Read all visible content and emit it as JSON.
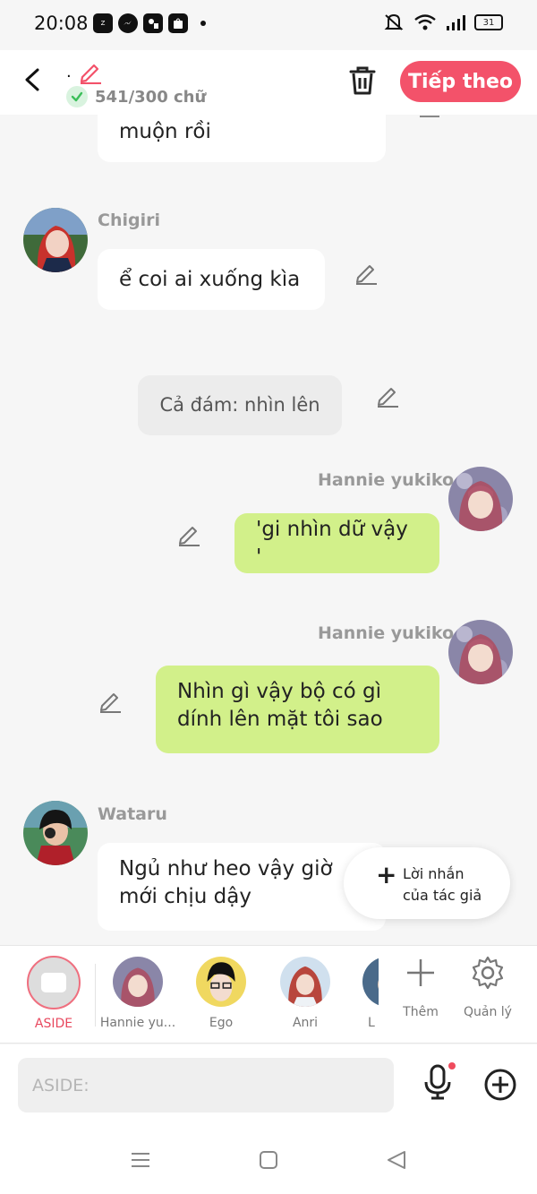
{
  "status_bar": {
    "time": "20:08",
    "app_icons": [
      "zalo-icon",
      "messenger-icon",
      "facebook-icon",
      "shopee-icon"
    ],
    "battery": "31"
  },
  "header": {
    "title": ".",
    "word_count": "541/300 chữ",
    "next_label": "Tiếp theo",
    "accent_color": "#f3526a"
  },
  "messages": [
    {
      "kind": "partial",
      "text": "muộn rồi"
    },
    {
      "sender": "Chigiri",
      "text": "ể coi ai xuống kìa"
    },
    {
      "kind": "narration",
      "text": "Cả đám: nhìn lên"
    },
    {
      "sender": "Hannie yukiko",
      "text": "'gi nhìn dữ vậy '"
    },
    {
      "sender": "Hannie yukiko",
      "line1": "Nhìn gì vậy bộ có gì",
      "line2": "dính lên mặt tôi sao"
    },
    {
      "sender": "Wataru",
      "line1": "Ngủ như heo vậy giờ",
      "line2": "mới chịu dậy"
    }
  ],
  "author_note": {
    "icon": "+",
    "line1": "Lời nhắn",
    "line2": "của tác giả"
  },
  "characters": [
    {
      "label": "ASIDE"
    },
    {
      "label": "Hannie yu..."
    },
    {
      "label": "Ego"
    },
    {
      "label": "Anri"
    },
    {
      "label": "L"
    }
  ],
  "actions": {
    "more_label": "Thêm",
    "manage_label": "Quản lý"
  },
  "input": {
    "placeholder": "ASIDE:"
  }
}
